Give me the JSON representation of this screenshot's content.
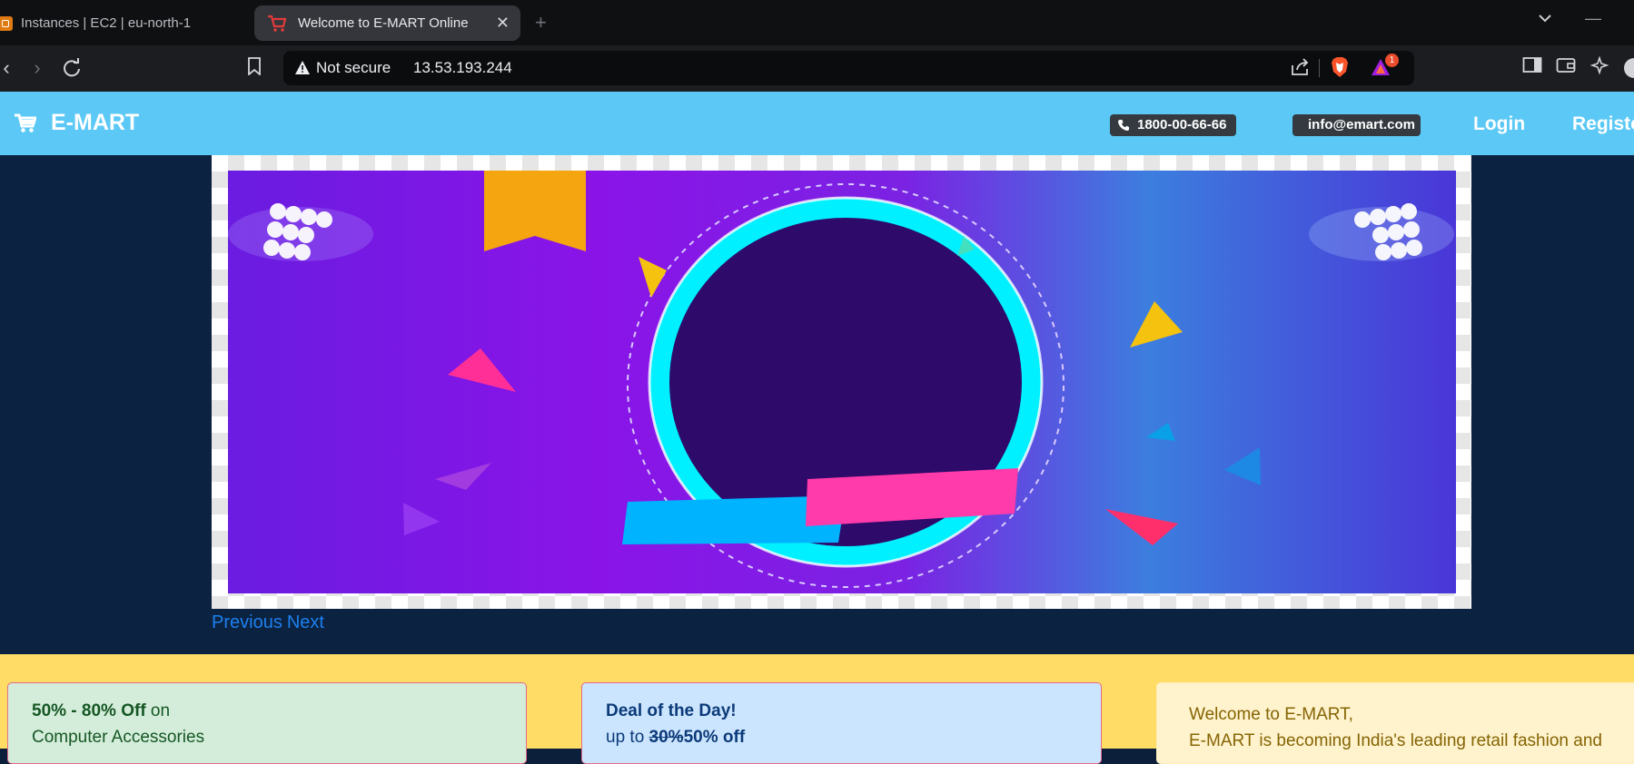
{
  "browser": {
    "tabs": [
      {
        "title": "Instances | EC2 | eu-north-1",
        "icon": "aws-ec2-icon",
        "active": false
      },
      {
        "title": "Welcome to E-MART Online",
        "icon": "cart-icon",
        "active": true
      }
    ],
    "security_label": "Not secure",
    "url": "13.53.193.244",
    "rewards_badge": "1"
  },
  "site": {
    "brand": "E-MART",
    "phone": "1800-00-66-66",
    "email": "info@emart.com",
    "nav": {
      "login": "Login",
      "register": "Registe"
    }
  },
  "carousel": {
    "previous": "Previous",
    "next": "Next"
  },
  "cards": {
    "c1": {
      "bold": "50% - 80% Off",
      "rest": " on",
      "line2": "Computer Accessories"
    },
    "c2": {
      "title": "Deal of the Day!",
      "prefix": "up to ",
      "old": "30%",
      "new": "50% off"
    },
    "c3": {
      "line1": "Welcome to E-MART,",
      "line2": "E-MART is becoming India's leading retail fashion and"
    }
  },
  "colors": {
    "navbar": "#5bc8f5",
    "hero_bg": "#0b2340",
    "features_bg": "#fedc65",
    "link": "#1d7ff0"
  }
}
